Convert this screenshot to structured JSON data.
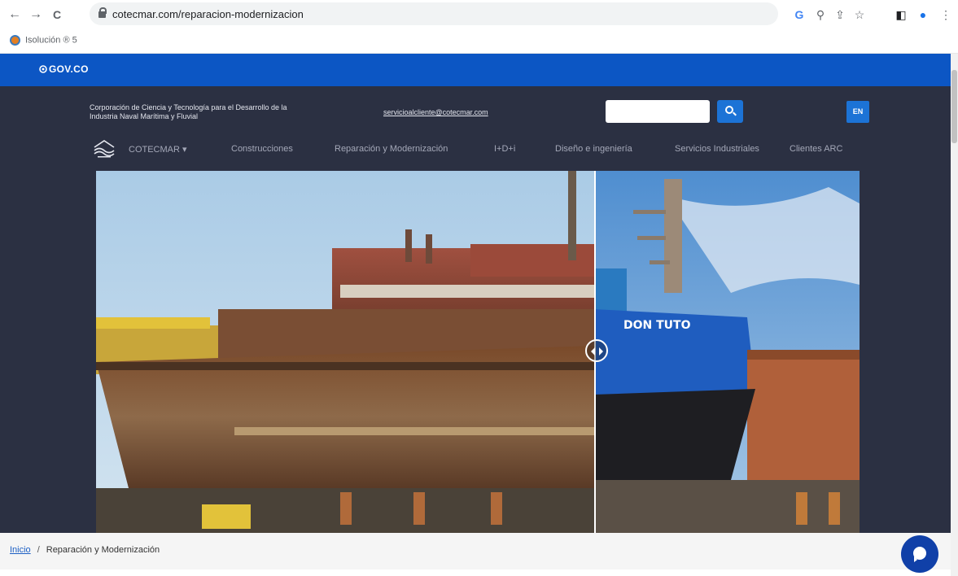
{
  "browser": {
    "url": "cotecmar.com/reparacion-modernizacion",
    "back_icon": "←",
    "forward_icon": "→",
    "reload_icon": "C",
    "google_icon": "G",
    "zoom_icon": "⚲",
    "share_icon": "⇪",
    "star_icon": "☆",
    "sidepanel_icon": "◧",
    "profile_icon": "●",
    "menu_icon": "⋮"
  },
  "bookmarks": {
    "items": [
      {
        "label": "Isolución ® 5"
      }
    ]
  },
  "gov_bar": {
    "logo_text": "GOV.CO",
    "color": "#0c56c4"
  },
  "header": {
    "org_name": "Corporación de Ciencia y Tecnología para el Desarrollo de la Industria Naval Marítima y Fluvial",
    "contact_email": "servicioalcliente@cotecmar.com",
    "search_placeholder": "",
    "language_button": "EN",
    "accent_color": "#1c73d6",
    "background_color": "#2b3042"
  },
  "nav": {
    "items": [
      {
        "label": "COTECMAR ▾"
      },
      {
        "label": "Construcciones"
      },
      {
        "label": "Reparación y Modernización"
      },
      {
        "label": "I+D+i"
      },
      {
        "label": "Diseño e ingeniería"
      },
      {
        "label": "Servicios Industriales"
      },
      {
        "label": "Clientes ARC"
      }
    ]
  },
  "hero": {
    "image_description_left": "rusty-ship-before",
    "image_description_right": "repaired-ship-after",
    "ship_name": "DON TUTO",
    "compare_split": 0.65
  },
  "breadcrumb": {
    "home": "Inicio",
    "separator": "/",
    "current": "Reparación y Modernización"
  },
  "chat": {
    "icon": "chat-bubble-icon"
  }
}
